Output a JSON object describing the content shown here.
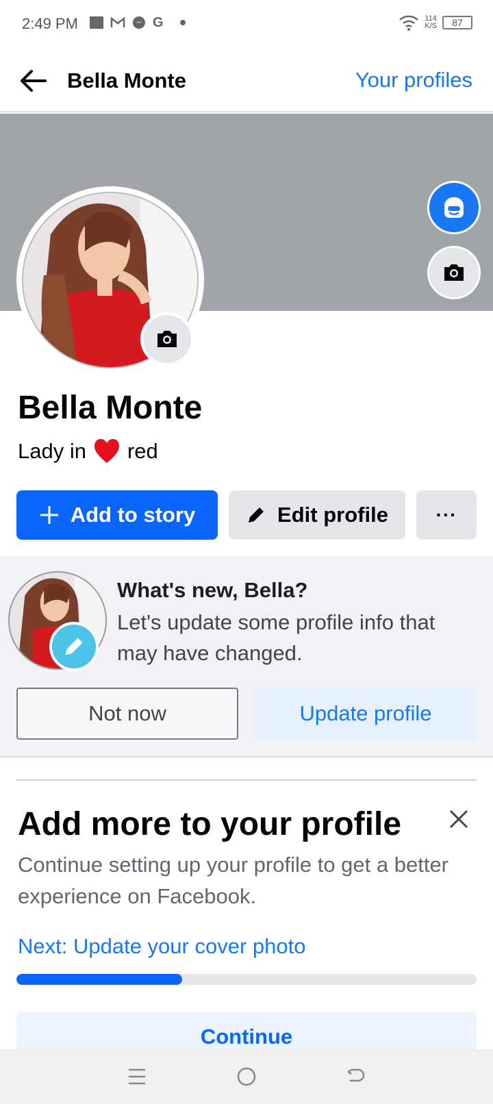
{
  "status_bar": {
    "time": "2:49 PM",
    "speed_top": "114",
    "speed_bottom": "K/S",
    "battery": "87",
    "icons": [
      "gallery-icon",
      "gmail-icon",
      "messenger-icon",
      "google-icon",
      "dot-icon",
      "wifi-icon",
      "battery-icon"
    ]
  },
  "nav": {
    "title": "Bella Monte",
    "link": "Your profiles"
  },
  "profile": {
    "name": "Bella Monte",
    "bio_before": "Lady in",
    "bio_emoji": "heart-emoji",
    "bio_after": "red"
  },
  "actions": {
    "add_story": "Add to story",
    "edit_profile": "Edit profile",
    "more": "···"
  },
  "whats_new": {
    "title": "What's new, Bella?",
    "body": "Let's update some profile info that may have changed.",
    "not_now": "Not now",
    "update": "Update profile"
  },
  "add_more": {
    "title": "Add more to your profile",
    "body": "Continue setting up your profile to get a better experience on Facebook.",
    "next": "Next: Update your cover photo",
    "progress": 0.36,
    "continue": "Continue"
  },
  "colors": {
    "accent": "#0866ff",
    "link": "#1877f2",
    "cover": "#a1a4a8"
  }
}
